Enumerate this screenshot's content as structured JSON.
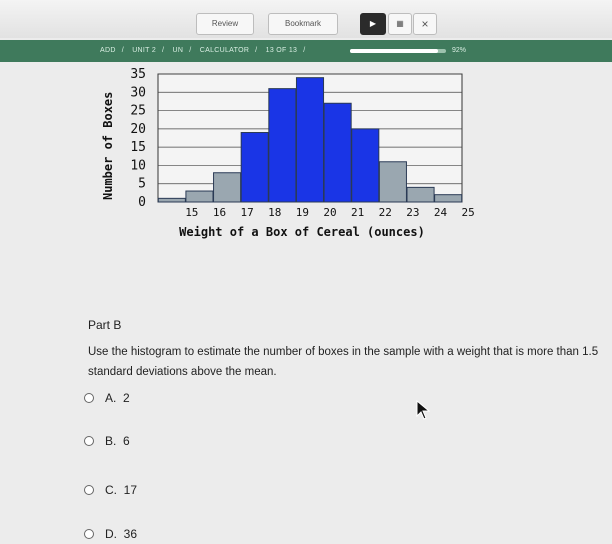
{
  "toolbar": {
    "review_label": "Review",
    "bookmark_label": "Bookmark",
    "close_glyph": "×"
  },
  "breadcrumb": {
    "items": [
      "ADD",
      "UNIT 2",
      "UN",
      "CALCULATOR",
      "13 OF 13"
    ],
    "progress_pct": 92,
    "progress_label": "92%"
  },
  "chart_data": {
    "type": "bar",
    "categories": [
      "15",
      "16",
      "17",
      "18",
      "19",
      "20",
      "21",
      "22",
      "23",
      "24",
      "25"
    ],
    "values": [
      1,
      3,
      8,
      19,
      31,
      34,
      27,
      20,
      11,
      4,
      2
    ],
    "xlabel": "Weight of a Box of Cereal (ounces)",
    "ylabel": "Number of Boxes",
    "ylim": [
      0,
      35
    ],
    "yticks": [
      0,
      5,
      10,
      15,
      20,
      25,
      30,
      35
    ],
    "grid": true,
    "colors": {
      "highlight": "#1a35e6",
      "normal": "#9aa7b0",
      "outline": "#2a3a55"
    },
    "highlight_categories": [
      "18",
      "19",
      "20",
      "21",
      "22"
    ]
  },
  "question": {
    "part": "Part B",
    "prompt": "Use the histogram to estimate the number of boxes in the sample with a weight that is more than 1.5 standard deviations above the mean.",
    "choices": [
      {
        "letter": "A.",
        "value": "2"
      },
      {
        "letter": "B.",
        "value": "6"
      },
      {
        "letter": "C.",
        "value": "17"
      },
      {
        "letter": "D.",
        "value": "36"
      }
    ]
  }
}
